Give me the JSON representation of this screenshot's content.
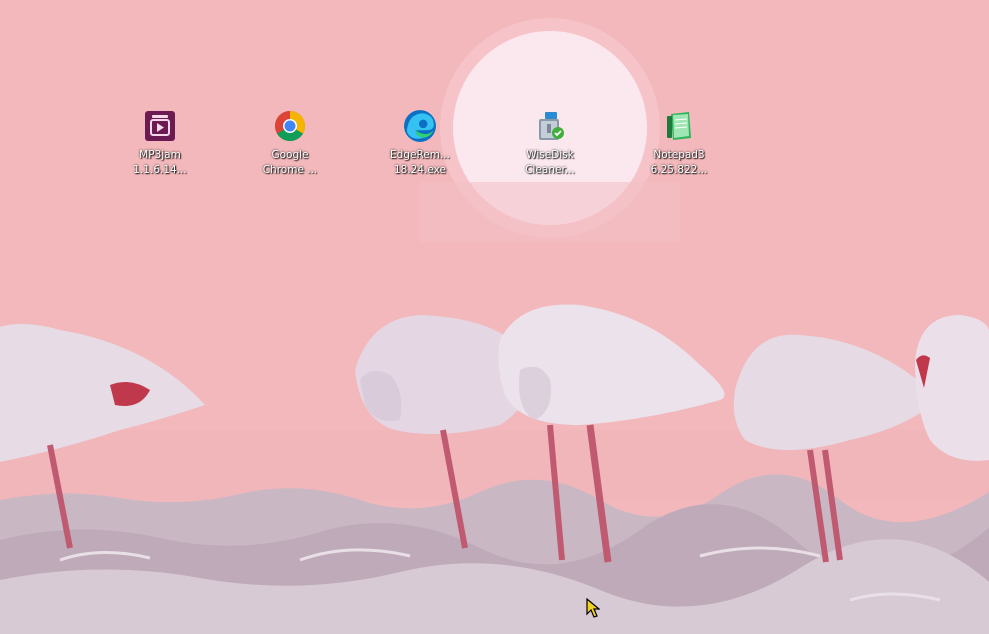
{
  "desktop": {
    "icons": [
      {
        "line1": "MP3jam",
        "line2": "1.1.6.14...",
        "icon": "mp3jam-icon"
      },
      {
        "line1": "Google",
        "line2": "Chrome ...",
        "icon": "chrome-icon"
      },
      {
        "line1": "EdgeRem...",
        "line2": "18.24.exe",
        "icon": "edge-icon"
      },
      {
        "line1": "WiseDisk",
        "line2": "Cleaner...",
        "icon": "wisedisk-cleaner-icon"
      },
      {
        "line1": "Notepad3",
        "line2": "6.25.822...",
        "icon": "notepad3-icon"
      }
    ]
  },
  "colors": {
    "sky": "#f2b8bb",
    "sun": "#fbe8ee",
    "water": "#c7b7c2",
    "flamingo_body": "#e7dbe6",
    "flamingo_leg": "#c05a70"
  }
}
